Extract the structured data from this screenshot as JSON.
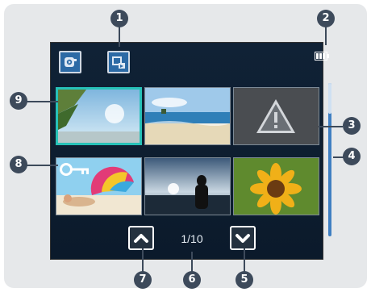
{
  "toolbar": {
    "mode_icon": "play-mode-icon",
    "view_icon": "thumbnail-view-icon",
    "battery_icon": "battery-full-icon"
  },
  "thumbnails": [
    {
      "name": "beach-palms",
      "selected": true,
      "locked": false
    },
    {
      "name": "beach-sea",
      "selected": false,
      "locked": false
    },
    {
      "name": "error-warning",
      "selected": false,
      "locked": false,
      "icon": "warning-icon"
    },
    {
      "name": "beach-umbrella",
      "selected": false,
      "locked": true,
      "icon": "key-icon"
    },
    {
      "name": "sunset-couple",
      "selected": false,
      "locked": false
    },
    {
      "name": "sunflower",
      "selected": false,
      "locked": false
    }
  ],
  "pager": {
    "page_text": "1/10",
    "prev_icon": "chevron-up-icon",
    "next_icon": "chevron-down-icon"
  },
  "scroll": {
    "position": 0.0,
    "visible_fraction": 0.2
  },
  "callouts": {
    "c1": "1",
    "c2": "2",
    "c3": "3",
    "c4": "4",
    "c5": "5",
    "c6": "6",
    "c7": "7",
    "c8": "8",
    "c9": "9"
  },
  "colors": {
    "screen_bg": "#0d1f33",
    "selection": "#27c1b8",
    "callout": "#3d4a5b",
    "scrollbar": "#3f7fc2"
  }
}
